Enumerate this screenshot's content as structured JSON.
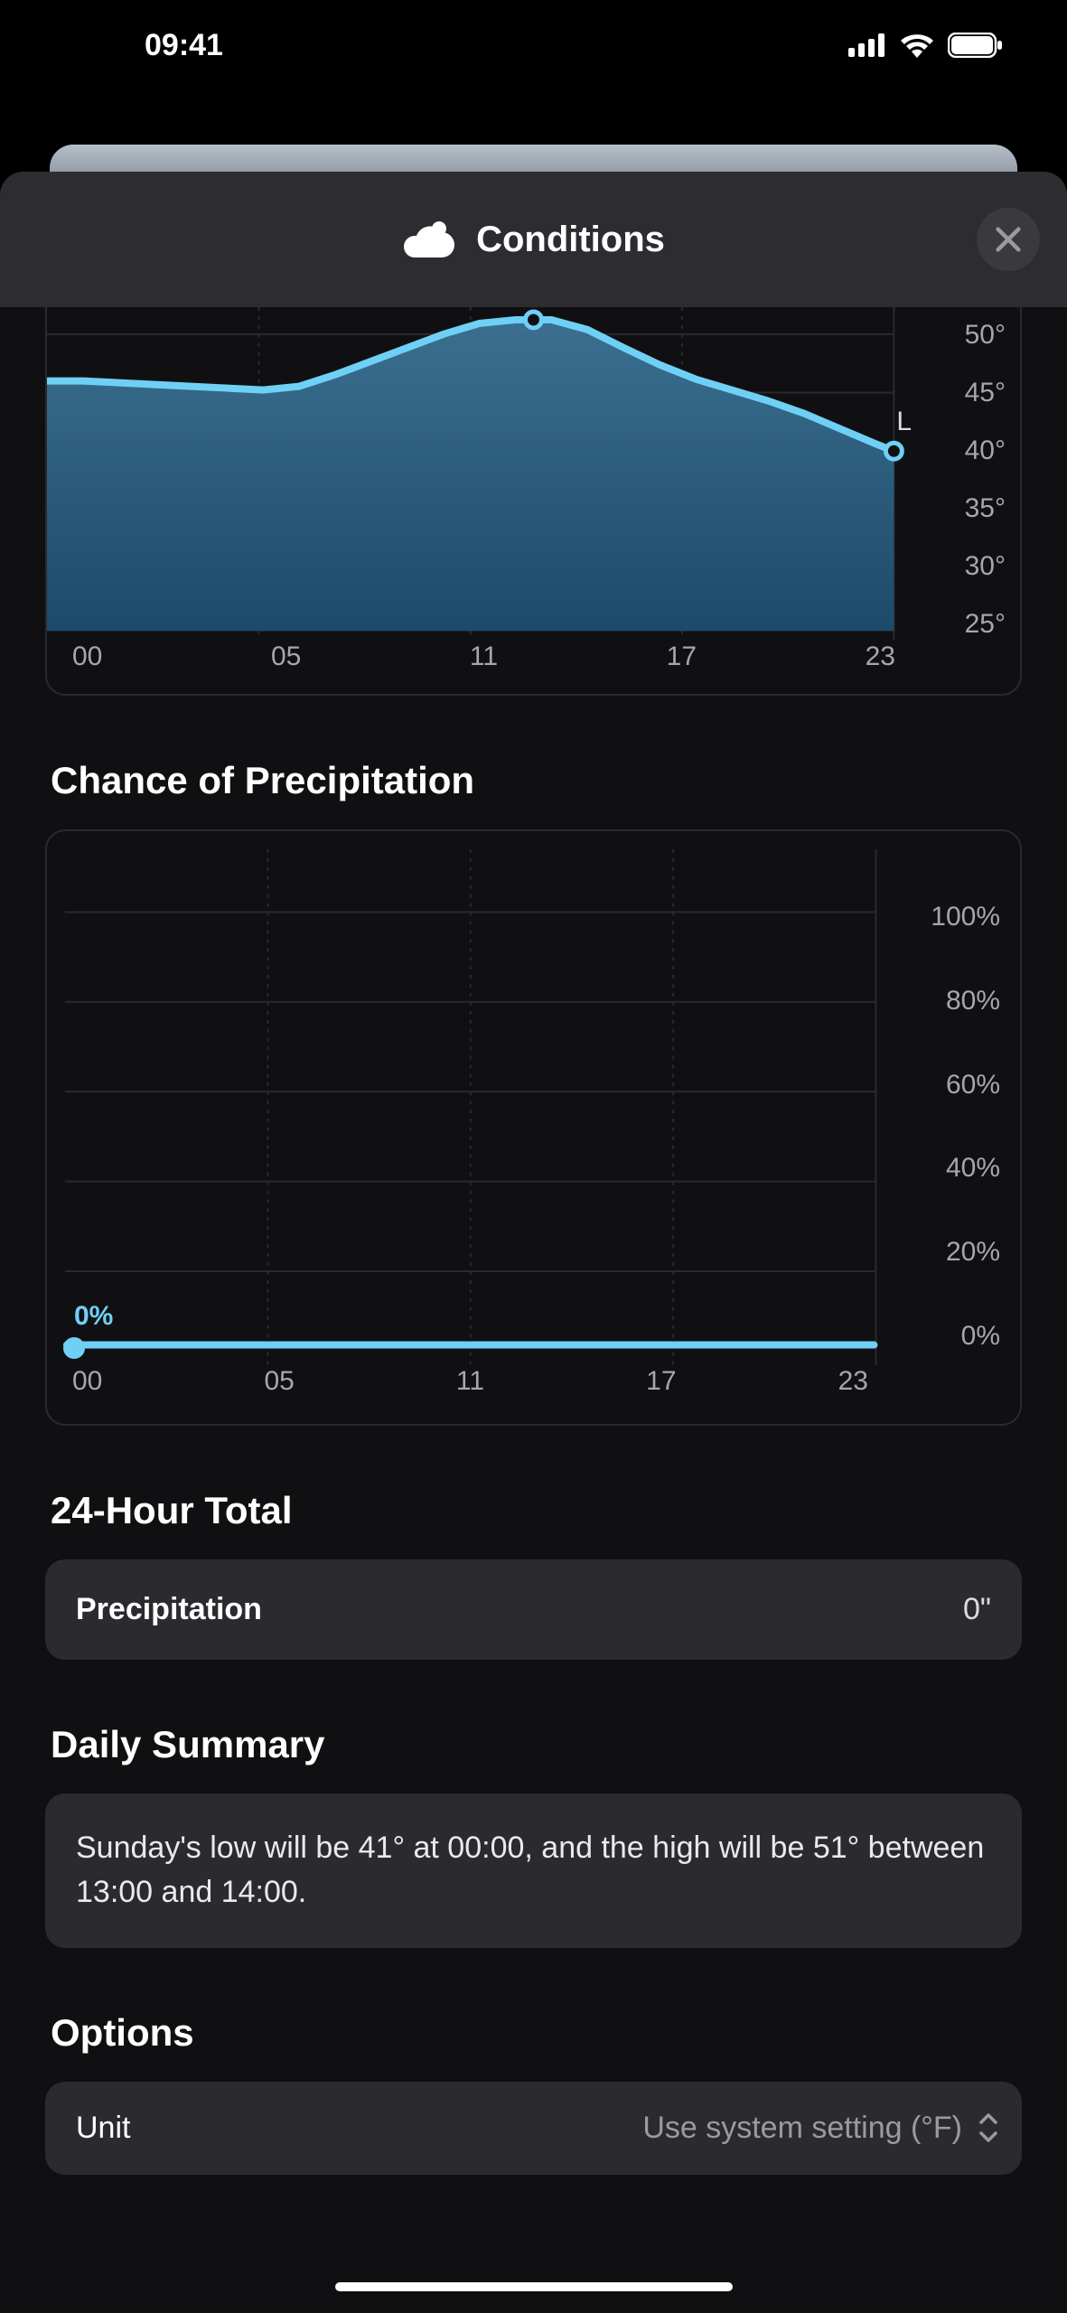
{
  "status": {
    "time": "09:41"
  },
  "header": {
    "title": "Conditions"
  },
  "temp_chart": {
    "y_ticks": [
      "50°",
      "45°",
      "40°",
      "35°",
      "30°",
      "25°"
    ],
    "x_ticks": [
      "00",
      "05",
      "11",
      "17",
      "23"
    ],
    "low_marker": "L"
  },
  "chart_data": [
    {
      "type": "area",
      "title": "Temperature",
      "xlabel": "",
      "ylabel": "°",
      "ylim": [
        25,
        50
      ],
      "x": [
        0,
        1,
        2,
        3,
        4,
        5,
        6,
        7,
        8,
        9,
        10,
        11,
        12,
        13,
        14,
        15,
        16,
        17,
        18,
        19,
        20,
        21,
        22,
        23
      ],
      "values": [
        46,
        46,
        46,
        45,
        45,
        45,
        46,
        47,
        48,
        49,
        50,
        51,
        51,
        51,
        51,
        50,
        49,
        48,
        47,
        46,
        45,
        44,
        42,
        41
      ],
      "annotations": [
        {
          "x": 11.5,
          "y": 51,
          "marker": "high"
        },
        {
          "x": 23,
          "y": 41,
          "label": "L",
          "marker": "low"
        }
      ]
    },
    {
      "type": "line",
      "title": "Chance of Precipitation",
      "xlabel": "",
      "ylabel": "%",
      "ylim": [
        0,
        100
      ],
      "x": [
        0,
        1,
        2,
        3,
        4,
        5,
        6,
        7,
        8,
        9,
        10,
        11,
        12,
        13,
        14,
        15,
        16,
        17,
        18,
        19,
        20,
        21,
        22,
        23
      ],
      "values": [
        0,
        0,
        0,
        0,
        0,
        0,
        0,
        0,
        0,
        0,
        0,
        0,
        0,
        0,
        0,
        0,
        0,
        0,
        0,
        0,
        0,
        0,
        0,
        0
      ],
      "annotations": [
        {
          "x": 0,
          "y": 0,
          "label": "0%",
          "marker": "now"
        }
      ]
    }
  ],
  "sections": {
    "precip_title": "Chance of Precipitation",
    "precip_y_ticks": [
      "100%",
      "80%",
      "60%",
      "40%",
      "20%",
      "0%"
    ],
    "precip_x_ticks": [
      "00",
      "05",
      "11",
      "17",
      "23"
    ],
    "precip_now_label": "0%",
    "total_title": "24-Hour Total",
    "total_row_label": "Precipitation",
    "total_row_value": "0\"",
    "summary_title": "Daily Summary",
    "summary_text": "Sunday's low will be 41° at 00:00, and the high will be 51° between 13:00 and 14:00.",
    "options_title": "Options",
    "unit_label": "Unit",
    "unit_value": "Use system setting (°F)"
  }
}
